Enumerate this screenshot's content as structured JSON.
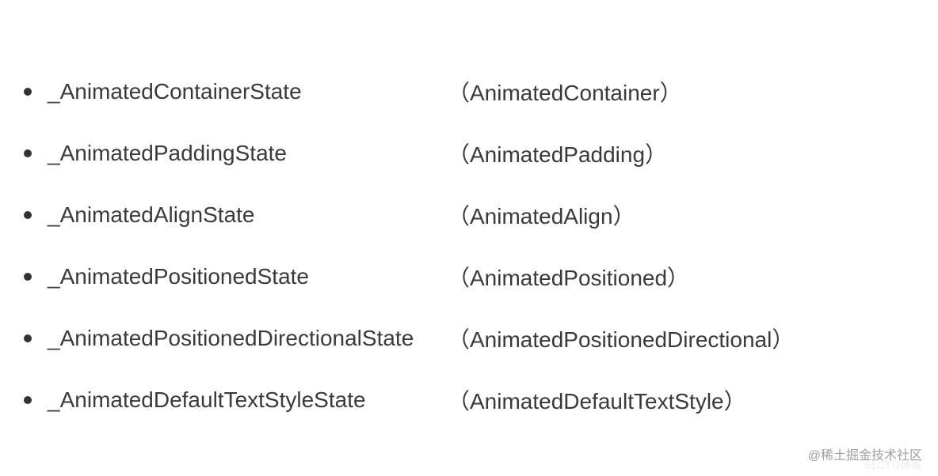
{
  "items": [
    {
      "state": "_AnimatedContainerState",
      "widget": "（AnimatedContainer）"
    },
    {
      "state": "_AnimatedPaddingState",
      "widget": "（AnimatedPadding）"
    },
    {
      "state": "_AnimatedAlignState",
      "widget": "（AnimatedAlign）"
    },
    {
      "state": "_AnimatedPositionedState",
      "widget": "（AnimatedPositioned）"
    },
    {
      "state": "_AnimatedPositionedDirectionalState",
      "widget": "（AnimatedPositionedDirectional）"
    },
    {
      "state": "_AnimatedDefaultTextStyleState",
      "widget": "（AnimatedDefaultTextStyle）"
    }
  ],
  "watermark": "@稀土掘金技术社区",
  "watermark2": "51CTO博客"
}
